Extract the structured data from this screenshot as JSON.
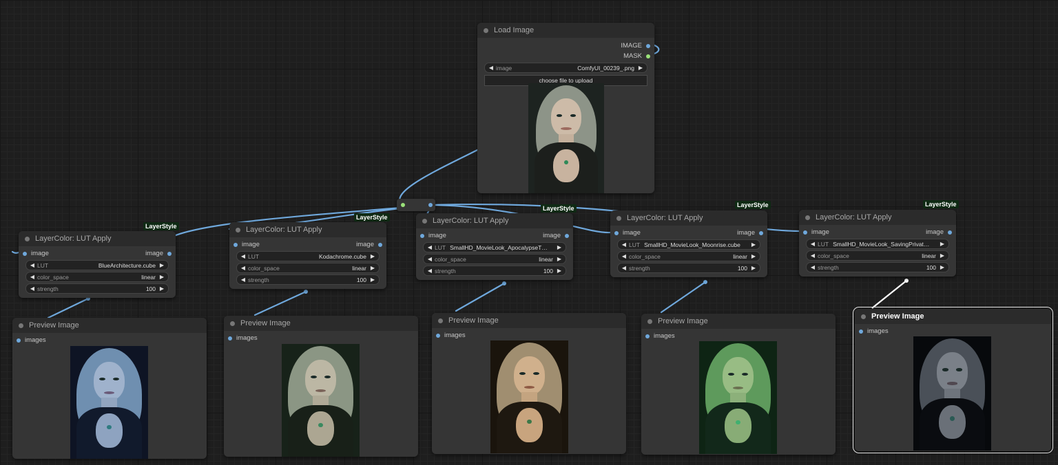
{
  "colors": {
    "canvas_bg": "#1e1e1e",
    "node_bg": "#353535",
    "node_title_bg": "#2b2b2b",
    "wire_image": "#6fa8dc",
    "slot_mask": "#9be27a",
    "badge_bg": "#0f2a14"
  },
  "load_image": {
    "title": "Load Image",
    "outputs": [
      "IMAGE",
      "MASK"
    ],
    "widget_label": "image",
    "widget_value": "ComfyUI_00239_.png",
    "upload_button": "choose file to upload"
  },
  "lut_nodes": [
    {
      "badge": "LayerStyle",
      "title": "LayerColor: LUT Apply",
      "input": "image",
      "output": "image",
      "lut_label": "LUT",
      "lut_value": "BlueArchitecture.cube",
      "cs_label": "color_space",
      "cs_value": "linear",
      "st_label": "strength",
      "st_value": "100"
    },
    {
      "badge": "LayerStyle",
      "title": "LayerColor: LUT Apply",
      "input": "image",
      "output": "image",
      "lut_label": "LUT",
      "lut_value": "Kodachrome.cube",
      "cs_label": "color_space",
      "cs_value": "linear",
      "st_label": "strength",
      "st_value": "100"
    },
    {
      "badge": "LayerStyle",
      "title": "LayerColor: LUT Apply",
      "input": "image",
      "output": "image",
      "lut_label": "LUT",
      "lut_value": "SmallHD_MovieLook_ApocalypseT…",
      "cs_label": "color_space",
      "cs_value": "linear",
      "st_label": "strength",
      "st_value": "100"
    },
    {
      "badge": "LayerStyle",
      "title": "LayerColor: LUT Apply",
      "input": "image",
      "output": "image",
      "lut_label": "LUT",
      "lut_value": "SmallHD_MovieLook_Moonrise.cube",
      "cs_label": "color_space",
      "cs_value": "linear",
      "st_label": "strength",
      "st_value": "100"
    },
    {
      "badge": "LayerStyle",
      "title": "LayerColor: LUT Apply",
      "input": "image",
      "output": "image",
      "lut_label": "LUT",
      "lut_value": "SmallHD_MovieLook_SavingPrivat…",
      "cs_label": "color_space",
      "cs_value": "linear",
      "st_label": "strength",
      "st_value": "100"
    }
  ],
  "preview_nodes": [
    {
      "title": "Preview Image",
      "input": "images",
      "tint": "blue"
    },
    {
      "title": "Preview Image",
      "input": "images",
      "tint": "teal"
    },
    {
      "title": "Preview Image",
      "input": "images",
      "tint": "warm"
    },
    {
      "title": "Preview Image",
      "input": "images",
      "tint": "green"
    },
    {
      "title": "Preview Image",
      "input": "images",
      "tint": "dark"
    }
  ]
}
